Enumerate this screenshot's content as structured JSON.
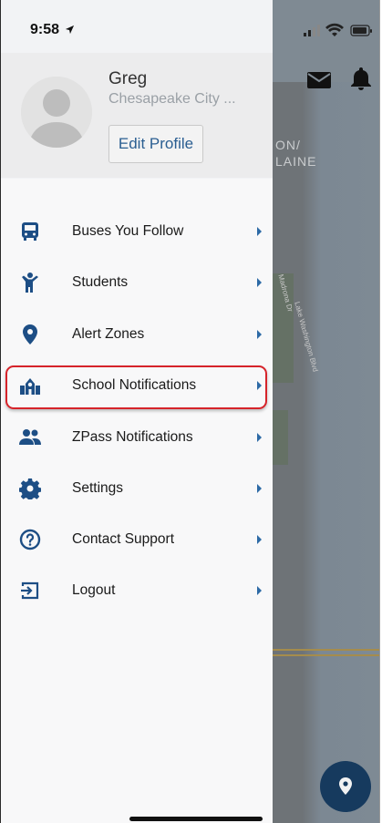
{
  "status_bar": {
    "time": "9:58"
  },
  "profile": {
    "name": "Greg",
    "district": "Chesapeake City ...",
    "edit_label": "Edit Profile"
  },
  "menu": {
    "items": [
      {
        "label": "Buses You Follow",
        "icon": "bus-icon"
      },
      {
        "label": "Students",
        "icon": "child-icon"
      },
      {
        "label": "Alert Zones",
        "icon": "map-marker-icon"
      },
      {
        "label": "School Notifications",
        "icon": "school-icon",
        "highlighted": true
      },
      {
        "label": "ZPass Notifications",
        "icon": "users-icon"
      },
      {
        "label": "Settings",
        "icon": "gear-icon"
      },
      {
        "label": "Contact Support",
        "icon": "question-circle-icon"
      },
      {
        "label": "Logout",
        "icon": "logout-icon"
      }
    ]
  },
  "map": {
    "neighborhood_label": "ON/\nLAINE",
    "streets": [
      "Madrona Dr",
      "Lake Washington Blvd"
    ]
  },
  "colors": {
    "accent": "#2a5e91",
    "icon": "#1d4e85",
    "highlight": "#d6232a",
    "fab": "#163a5e"
  }
}
